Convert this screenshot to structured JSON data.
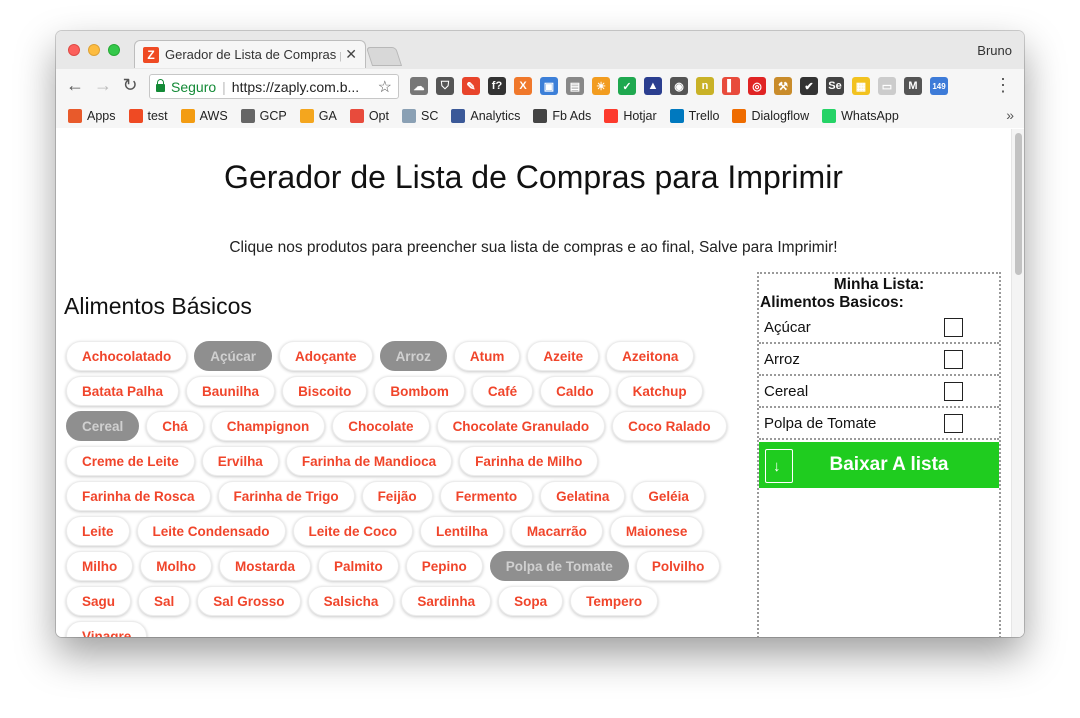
{
  "browser": {
    "tab_title": "Gerador de Lista de Compras p",
    "profile_name": "Bruno",
    "omnibox": {
      "secure_label": "Seguro",
      "url": "https://zaply.com.b..."
    },
    "extensions": [
      {
        "icon": "cloud-icon",
        "color": "#777777",
        "text": "☁"
      },
      {
        "icon": "shield-icon",
        "color": "#555555",
        "text": "⛉"
      },
      {
        "icon": "eyedropper-icon",
        "color": "#e8442b",
        "text": "✎"
      },
      {
        "icon": "font-icon",
        "color": "#333333",
        "text": "f?"
      },
      {
        "icon": "xo-icon",
        "color": "#f0782b",
        "text": "X"
      },
      {
        "icon": "box-icon",
        "color": "#3c7fd8",
        "text": "▣"
      },
      {
        "icon": "stack-icon",
        "color": "#888888",
        "text": "▤"
      },
      {
        "icon": "sun-icon",
        "color": "#f29c1f",
        "text": "☀"
      },
      {
        "icon": "check-icon",
        "color": "#1fa84f",
        "text": "✓"
      },
      {
        "icon": "rocket-icon",
        "color": "#2b3e8f",
        "text": "▲"
      },
      {
        "icon": "lightbulb-icon",
        "color": "#555555",
        "text": "◉"
      },
      {
        "icon": "n-icon",
        "color": "#c9b227",
        "text": "n"
      },
      {
        "icon": "bars-icon",
        "color": "#e84b3c",
        "text": "▌"
      },
      {
        "icon": "ring-icon",
        "color": "#e02424",
        "text": "◎"
      },
      {
        "icon": "tool-icon",
        "color": "#c98c2b",
        "text": "⚒"
      },
      {
        "icon": "edit-icon",
        "color": "#333333",
        "text": "✔"
      },
      {
        "icon": "se-icon",
        "color": "#444444",
        "text": "Se"
      },
      {
        "icon": "note-icon",
        "color": "#f2c21f",
        "text": "▦"
      },
      {
        "icon": "chat-icon",
        "color": "#cccccc",
        "text": "▭"
      },
      {
        "icon": "gmail-icon",
        "color": "#555555",
        "text": "M"
      },
      {
        "icon": "counter-icon",
        "color": "#3d7bd8",
        "text": "149"
      }
    ],
    "bookmarks": [
      {
        "label": "Apps",
        "icon": "apps-grid-icon",
        "color": "#e85a2b"
      },
      {
        "label": "test",
        "icon": "z-icon",
        "color": "#ef4a23"
      },
      {
        "label": "AWS",
        "icon": "aws-cube-icon",
        "color": "#f39c12"
      },
      {
        "label": "GCP",
        "icon": "gcp-icon",
        "color": "#666666"
      },
      {
        "label": "GA",
        "icon": "analytics-bars-icon",
        "color": "#f4a61e"
      },
      {
        "label": "Opt",
        "icon": "opt-icon",
        "color": "#e84b3c"
      },
      {
        "label": "SC",
        "icon": "sc-icon",
        "color": "#8aa0b4"
      },
      {
        "label": "Analytics",
        "icon": "facebook-icon",
        "color": "#3b5998"
      },
      {
        "label": "Fb Ads",
        "icon": "fb-ads-icon",
        "color": "#444444"
      },
      {
        "label": "Hotjar",
        "icon": "flame-icon",
        "color": "#fd3a2d"
      },
      {
        "label": "Trello",
        "icon": "trello-icon",
        "color": "#0079bf"
      },
      {
        "label": "Dialogflow",
        "icon": "dialogflow-icon",
        "color": "#ef6c00"
      },
      {
        "label": "WhatsApp",
        "icon": "whatsapp-icon",
        "color": "#25d366"
      }
    ]
  },
  "page": {
    "title": "Gerador de Lista de Compras para Imprimir",
    "subtitle": "Clique nos produtos para preencher sua lista de compras e ao final, Salve para Imprimir!",
    "section_title": "Alimentos Básicos",
    "products": [
      {
        "label": "Achocolatado",
        "selected": false
      },
      {
        "label": "Açúcar",
        "selected": true
      },
      {
        "label": "Adoçante",
        "selected": false
      },
      {
        "label": "Arroz",
        "selected": true
      },
      {
        "label": "Atum",
        "selected": false
      },
      {
        "label": "Azeite",
        "selected": false
      },
      {
        "label": "Azeitona",
        "selected": false
      },
      {
        "label": "Batata Palha",
        "selected": false
      },
      {
        "label": "Baunilha",
        "selected": false
      },
      {
        "label": "Biscoito",
        "selected": false
      },
      {
        "label": "Bombom",
        "selected": false
      },
      {
        "label": "Café",
        "selected": false
      },
      {
        "label": "Caldo",
        "selected": false
      },
      {
        "label": "Katchup",
        "selected": false
      },
      {
        "label": "Cereal",
        "selected": true
      },
      {
        "label": "Chá",
        "selected": false
      },
      {
        "label": "Champignon",
        "selected": false
      },
      {
        "label": "Chocolate",
        "selected": false
      },
      {
        "label": "Chocolate Granulado",
        "selected": false
      },
      {
        "label": "Coco Ralado",
        "selected": false
      },
      {
        "label": "Creme de Leite",
        "selected": false
      },
      {
        "label": "Ervilha",
        "selected": false
      },
      {
        "label": "Farinha de Mandioca",
        "selected": false
      },
      {
        "label": "Farinha de Milho",
        "selected": false
      },
      {
        "label": "Farinha de Rosca",
        "selected": false
      },
      {
        "label": "Farinha de Trigo",
        "selected": false
      },
      {
        "label": "Feijão",
        "selected": false
      },
      {
        "label": "Fermento",
        "selected": false
      },
      {
        "label": "Gelatina",
        "selected": false
      },
      {
        "label": "Geléia",
        "selected": false
      },
      {
        "label": "Leite",
        "selected": false
      },
      {
        "label": "Leite Condensado",
        "selected": false
      },
      {
        "label": "Leite de Coco",
        "selected": false
      },
      {
        "label": "Lentilha",
        "selected": false
      },
      {
        "label": "Macarrão",
        "selected": false
      },
      {
        "label": "Maionese",
        "selected": false
      },
      {
        "label": "Milho",
        "selected": false
      },
      {
        "label": "Molho",
        "selected": false
      },
      {
        "label": "Mostarda",
        "selected": false
      },
      {
        "label": "Palmito",
        "selected": false
      },
      {
        "label": "Pepino",
        "selected": false
      },
      {
        "label": "Polpa de Tomate",
        "selected": true
      },
      {
        "label": "Polvilho",
        "selected": false
      },
      {
        "label": "Sagu",
        "selected": false
      },
      {
        "label": "Sal",
        "selected": false
      },
      {
        "label": "Sal Grosso",
        "selected": false
      },
      {
        "label": "Salsicha",
        "selected": false
      },
      {
        "label": "Sardinha",
        "selected": false
      },
      {
        "label": "Sopa",
        "selected": false
      },
      {
        "label": "Tempero",
        "selected": false
      },
      {
        "label": "Vinagre",
        "selected": false
      }
    ]
  },
  "my_list": {
    "title": "Minha Lista:",
    "category": "Alimentos Basicos:",
    "items": [
      {
        "label": "Açúcar",
        "checked": false
      },
      {
        "label": "Arroz",
        "checked": false
      },
      {
        "label": "Cereal",
        "checked": false
      },
      {
        "label": "Polpa de Tomate",
        "checked": false
      }
    ],
    "download_label": "Baixar A lista"
  },
  "colors": {
    "chip_text": "#f0452b",
    "chip_selected_bg": "#8f8f8f",
    "download_green": "#1fcc1f"
  }
}
